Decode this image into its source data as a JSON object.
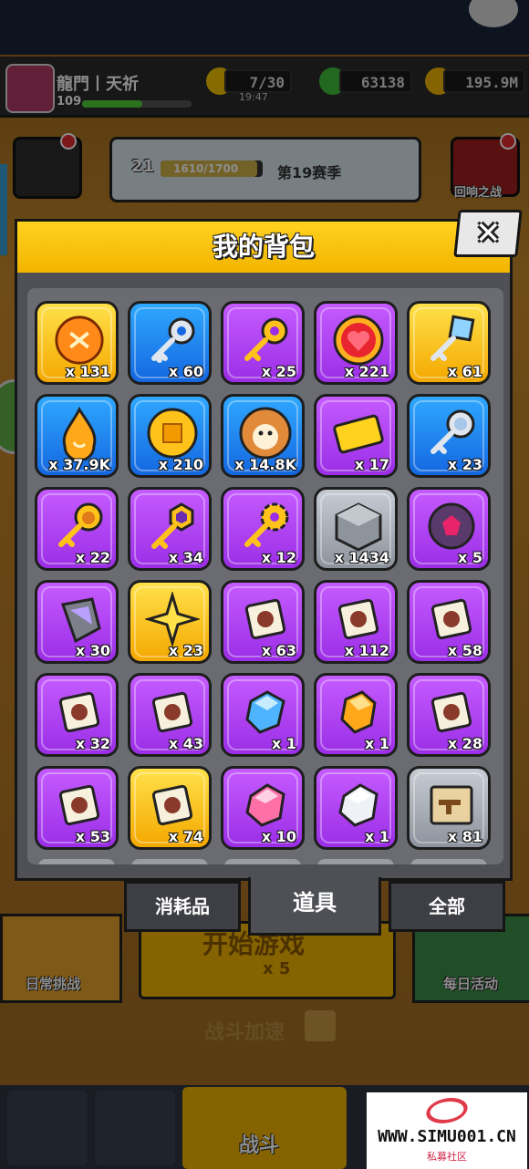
{
  "player": {
    "name": "龍門丨天祈",
    "level": "109"
  },
  "stats": {
    "energy": "7/30",
    "energy_timer": "19:47",
    "gems": "63138",
    "coins": "195.9M"
  },
  "season": {
    "level": "21",
    "progress": "1610/1700",
    "progress_fraction": 0.947,
    "label": "第19赛季"
  },
  "side": {
    "echo_battle": "回响之战",
    "daily_challenge": "日常挑战",
    "daily_activity": "每日活动"
  },
  "center": {
    "start_game": "开始游戏",
    "start_cost": "x 5",
    "battle_boost": "战斗加速"
  },
  "bottom_nav": {
    "battle": "战斗"
  },
  "bag": {
    "title": "我的背包",
    "close_label": "✕",
    "items": [
      {
        "name": "orange-token",
        "rarity": "gold",
        "qty": "x 131",
        "icon": "orange-coin-icon"
      },
      {
        "name": "silver-key",
        "rarity": "blue",
        "qty": "x 60",
        "icon": "silver-key-icon"
      },
      {
        "name": "gold-key",
        "rarity": "purple",
        "qty": "x 25",
        "icon": "gold-key-icon"
      },
      {
        "name": "heart-orb",
        "rarity": "purple",
        "qty": "x 221",
        "icon": "heart-orb-icon"
      },
      {
        "name": "crystal-key",
        "rarity": "gold",
        "qty": "x 61",
        "icon": "crystal-key-icon"
      },
      {
        "name": "flame-essence",
        "rarity": "blue",
        "qty": "x 37.9K",
        "icon": "flame-drop-icon"
      },
      {
        "name": "gold-coin",
        "rarity": "blue",
        "qty": "x 210",
        "icon": "gold-coin-icon"
      },
      {
        "name": "dog-medal",
        "rarity": "blue",
        "qty": "x 14.8K",
        "icon": "dog-medal-icon"
      },
      {
        "name": "gold-ticket",
        "rarity": "purple",
        "qty": "x 17",
        "icon": "gold-ticket-icon"
      },
      {
        "name": "pet-key",
        "rarity": "blue",
        "qty": "x 23",
        "icon": "pet-key-icon"
      },
      {
        "name": "bear-key",
        "rarity": "purple",
        "qty": "x 22",
        "icon": "bear-key-icon"
      },
      {
        "name": "hex-key",
        "rarity": "purple",
        "qty": "x 34",
        "icon": "hex-key-icon"
      },
      {
        "name": "gear-key",
        "rarity": "purple",
        "qty": "x 12",
        "icon": "gear-key-icon"
      },
      {
        "name": "cube-stone",
        "rarity": "gray",
        "qty": "x 1434",
        "icon": "cube-stone-icon"
      },
      {
        "name": "gem-rock",
        "rarity": "purple",
        "qty": "x 5",
        "icon": "gem-rock-icon"
      },
      {
        "name": "dark-crystal",
        "rarity": "purple",
        "qty": "x 30",
        "icon": "dark-crystal-icon"
      },
      {
        "name": "star-shard",
        "rarity": "gold",
        "qty": "x 23",
        "icon": "star-shard-icon"
      },
      {
        "name": "puzzle-piece-1",
        "rarity": "purple",
        "qty": "x 63",
        "icon": "puzzle-piece-icon"
      },
      {
        "name": "puzzle-piece-2",
        "rarity": "purple",
        "qty": "x 112",
        "icon": "puzzle-piece-icon"
      },
      {
        "name": "puzzle-piece-3",
        "rarity": "purple",
        "qty": "x 58",
        "icon": "puzzle-piece-icon"
      },
      {
        "name": "puzzle-piece-4",
        "rarity": "purple",
        "qty": "x 32",
        "icon": "puzzle-piece-icon"
      },
      {
        "name": "puzzle-piece-5",
        "rarity": "purple",
        "qty": "x 43",
        "icon": "puzzle-piece-icon"
      },
      {
        "name": "blue-gem",
        "rarity": "purple",
        "qty": "x 1",
        "icon": "blue-gem-icon"
      },
      {
        "name": "amber-gem",
        "rarity": "purple",
        "qty": "x 1",
        "icon": "amber-gem-icon"
      },
      {
        "name": "puzzle-piece-6",
        "rarity": "purple",
        "qty": "x 28",
        "icon": "puzzle-piece-icon"
      },
      {
        "name": "puzzle-piece-7",
        "rarity": "purple",
        "qty": "x 53",
        "icon": "puzzle-piece-icon"
      },
      {
        "name": "puzzle-piece-8",
        "rarity": "gold",
        "qty": "x 74",
        "icon": "puzzle-piece-icon"
      },
      {
        "name": "pink-gem",
        "rarity": "purple",
        "qty": "x 10",
        "icon": "pink-gem-icon"
      },
      {
        "name": "white-gem",
        "rarity": "purple",
        "qty": "x 1",
        "icon": "white-gem-icon"
      },
      {
        "name": "weapon-blueprint",
        "rarity": "gray",
        "qty": "x 81",
        "icon": "scroll-icon"
      }
    ],
    "tabs": [
      {
        "id": "consumables",
        "label": "消耗品",
        "active": false
      },
      {
        "id": "items",
        "label": "道具",
        "active": true
      },
      {
        "id": "all",
        "label": "全部",
        "active": false
      }
    ]
  },
  "watermark": {
    "text": "WWW.SIMU001.CN",
    "sub": "私募社区"
  },
  "colors": {
    "header_yellow": "#ffd21e",
    "panel": "#4e5056",
    "purple": "#b44af5",
    "blue": "#1f8af0",
    "gold": "#ffc21a",
    "gray": "#a8adb5"
  }
}
